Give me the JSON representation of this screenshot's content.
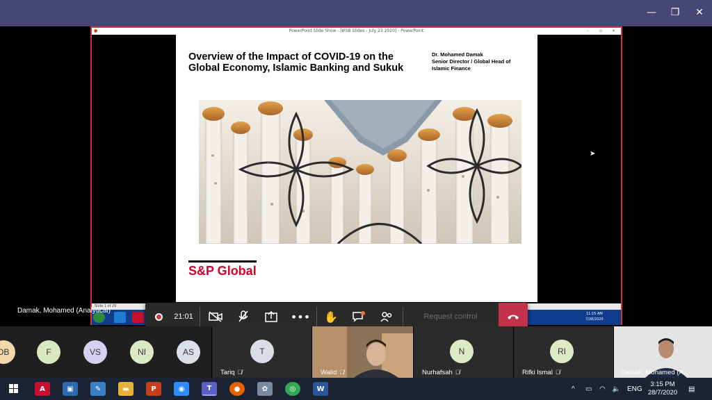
{
  "window": {
    "minimize": "—",
    "restore": "❐",
    "close": "✕"
  },
  "powerpoint": {
    "title": "PowerPoint Slide Show - [IFSB Slides - July 23 2020] - PowerPoint",
    "status": "Slide 1 of 29",
    "tray_time": "11:15 AM",
    "tray_date": "7/28/2020",
    "tray_lang": "FR"
  },
  "slide": {
    "title": "Overview of the Impact of COVID-19 on the Global Economy, Islamic Banking and Sukuk",
    "author_name": "Dr. Mohamed Damak",
    "author_role": "Senior Director / Global Head of Islamic Finance",
    "logo": "S&P Global"
  },
  "meeting_bar": {
    "timer": "21:01",
    "request_control": "Request control"
  },
  "presenter_label": "Damak, Mohamed (Analytical)",
  "participants": [
    {
      "initials": "DB",
      "name": "",
      "color": "#f2d7a8"
    },
    {
      "initials": "F",
      "name": "",
      "color": "#d9e8c0"
    },
    {
      "initials": "VS",
      "name": "",
      "color": "#d8d0f0"
    },
    {
      "initials": "NI",
      "name": "",
      "color": "#dbeac4"
    },
    {
      "initials": "AS",
      "name": "",
      "color": "#d9e0e8"
    },
    {
      "initials": "T",
      "name": "Tariq",
      "color": "#d9dde8"
    },
    {
      "initials": "",
      "name": "Walid",
      "color": ""
    },
    {
      "initials": "N",
      "name": "Nurhafsah",
      "color": "#dbeac4"
    },
    {
      "initials": "RI",
      "name": "Rifki Ismal",
      "color": "#dbeac4"
    },
    {
      "initials": "",
      "name": "Damak, Mohamed (A...",
      "color": ""
    }
  ],
  "taskbar": {
    "lang": "ENG",
    "time": "3:15 PM",
    "date": "28/7/2020"
  }
}
